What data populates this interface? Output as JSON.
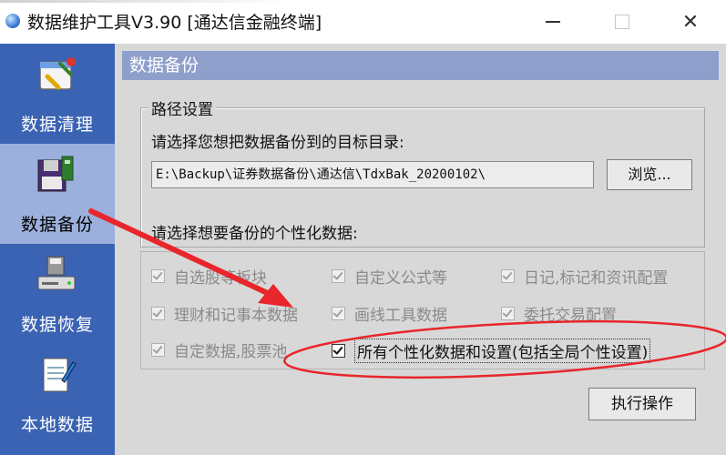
{
  "window": {
    "title": "数据维护工具V3.90 [通达信金融终端]",
    "controls": {
      "minimize": "—",
      "maximize": "□",
      "close": "✕"
    }
  },
  "sidebar": {
    "items": [
      {
        "label": "数据清理",
        "icon": "clean-tools-icon",
        "active": false
      },
      {
        "label": "数据备份",
        "icon": "backup-disk-icon",
        "active": true
      },
      {
        "label": "数据恢复",
        "icon": "restore-drive-icon",
        "active": false
      },
      {
        "label": "本地数据",
        "icon": "notepad-icon",
        "active": false
      }
    ]
  },
  "main": {
    "section_title": "数据备份",
    "path_group": {
      "legend": "路径设置",
      "prompt": "请选择您想把数据备份到的目标目录:",
      "path_value": "E:\\Backup\\证券数据备份\\通达信\\TdxBak_20200102\\",
      "browse_label": "浏览..."
    },
    "options_label": "请选择想要备份的个性化数据:",
    "options": [
      {
        "label": "自选股等板块",
        "checked": true,
        "enabled": false
      },
      {
        "label": "自定义公式等",
        "checked": true,
        "enabled": false
      },
      {
        "label": "日记,标记和资讯配置",
        "checked": true,
        "enabled": false
      },
      {
        "label": "理财和记事本数据",
        "checked": true,
        "enabled": false
      },
      {
        "label": "画线工具数据",
        "checked": true,
        "enabled": false
      },
      {
        "label": "委托交易配置",
        "checked": true,
        "enabled": false
      },
      {
        "label": "自定数据,股票池",
        "checked": true,
        "enabled": false
      },
      {
        "label": "所有个性化数据和设置(包括全局个性设置)",
        "checked": true,
        "enabled": true
      }
    ],
    "execute_label": "执行操作"
  },
  "colors": {
    "sidebar_bg": "#3b63b4",
    "sidebar_active": "#9bb0dc",
    "header_bar": "#8e9fcc",
    "annotation_red": "#e8262b"
  }
}
